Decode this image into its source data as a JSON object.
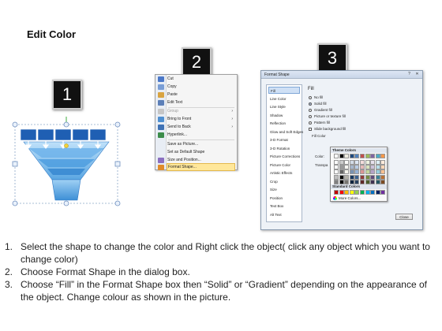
{
  "title": "Edit Color",
  "badges": [
    "1",
    "2",
    "3"
  ],
  "context_menu": {
    "items": [
      {
        "label": "Cut",
        "icon": "scissors-icon",
        "state": "normal"
      },
      {
        "label": "Copy",
        "icon": "copy-icon",
        "state": "normal"
      },
      {
        "label": "Paste",
        "icon": "paste-icon",
        "state": "normal"
      },
      {
        "label": "Edit Text",
        "icon": "edit-text-icon",
        "state": "normal"
      },
      {
        "label": "Group",
        "icon": "group-icon",
        "state": "disabled",
        "arrow": "›"
      },
      {
        "label": "Bring to Front",
        "icon": "bring-front-icon",
        "state": "normal",
        "arrow": "›"
      },
      {
        "label": "Send to Back",
        "icon": "send-back-icon",
        "state": "normal",
        "arrow": "›"
      },
      {
        "label": "Hyperlink...",
        "icon": "hyperlink-icon",
        "state": "normal"
      },
      {
        "label": "Save as Picture...",
        "icon": "",
        "state": "normal"
      },
      {
        "label": "Set as Default Shape",
        "icon": "",
        "state": "normal"
      },
      {
        "label": "Size and Position...",
        "icon": "size-icon",
        "state": "normal"
      },
      {
        "label": "Format Shape...",
        "icon": "format-shape-icon",
        "state": "highlighted"
      }
    ]
  },
  "dialog": {
    "title": "Format Shape",
    "controls": {
      "help": "?",
      "close": "✕"
    },
    "sidebar": [
      "Fill",
      "Line Color",
      "Line Style",
      "Shadow",
      "Reflection",
      "Glow and Soft Edges",
      "3-D Format",
      "3-D Rotation",
      "Picture Corrections",
      "Picture Color",
      "Artistic Effects",
      "Crop",
      "Size",
      "Position",
      "Text Box",
      "Alt Text"
    ],
    "selected_index": 0,
    "fill_heading": "Fill",
    "options": [
      {
        "label": "No fill",
        "kind": "radio",
        "checked": false
      },
      {
        "label": "Solid fill",
        "kind": "radio",
        "checked": true
      },
      {
        "label": "Gradient fill",
        "kind": "radio",
        "checked": false
      },
      {
        "label": "Picture or texture fill",
        "kind": "radio",
        "checked": false
      },
      {
        "label": "Pattern fill",
        "kind": "radio",
        "checked": false
      },
      {
        "label": "Slide background fill",
        "kind": "checkbox",
        "checked": false
      }
    ],
    "fill_color_label": "Fill Color",
    "color_label": "Color:",
    "transparency_label": "Transpa",
    "close_button": "Close"
  },
  "palette": {
    "theme_heading": "Theme Colors",
    "standard_heading": "Standard Colors",
    "more_colors": "More Colors...",
    "theme_colors": [
      "#ffffff",
      "#000000",
      "#eeece1",
      "#1f497d",
      "#4f81bd",
      "#c0504d",
      "#9bbb59",
      "#8064a2",
      "#4bacc6",
      "#f79646"
    ],
    "standard_colors": [
      "#c00000",
      "#ff0000",
      "#ffc000",
      "#ffff00",
      "#92d050",
      "#00b050",
      "#00b0f0",
      "#0070c0",
      "#002060",
      "#7030a0"
    ]
  },
  "instructions": [
    {
      "num": "1.",
      "text": "Select the shape to change the color and Right click the object( click any object which you want to change color)"
    },
    {
      "num": "2.",
      "text": "Choose Format Shape in the dialog box."
    },
    {
      "num": "3.",
      "text": "Choose “Fill” in the Format Shape box then “Solid” or “Gradient” depending on the appearance of the object. Change colour as shown in the picture."
    }
  ]
}
